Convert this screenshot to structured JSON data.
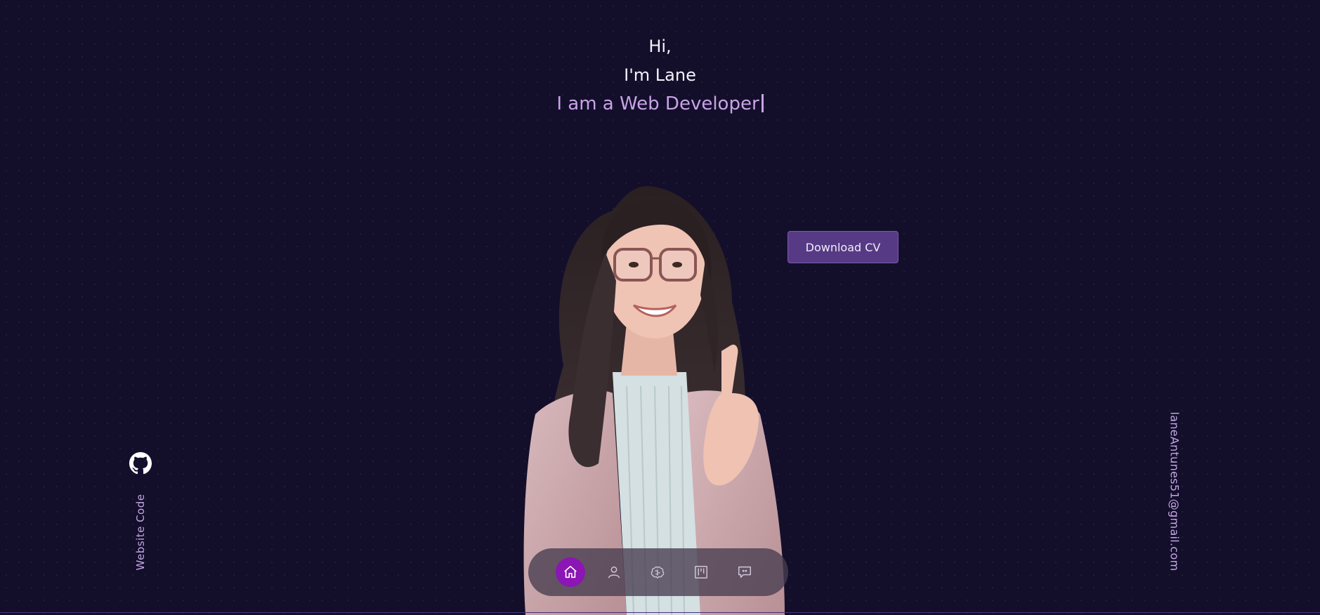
{
  "hero": {
    "greeting": "Hi,",
    "name_line": "I'm Lane",
    "role_line": "I am a Web Developer"
  },
  "actions": {
    "download_cv": "Download CV"
  },
  "social": {
    "github_icon": "github-icon",
    "website_code_label": "Website Code"
  },
  "contact": {
    "email": "laneAntunes51@gmail.com"
  },
  "nav": {
    "items": [
      {
        "icon": "home-icon",
        "active": true
      },
      {
        "icon": "user-icon",
        "active": false
      },
      {
        "icon": "brain-icon",
        "active": false
      },
      {
        "icon": "kanban-board-icon",
        "active": false
      },
      {
        "icon": "chat-icon",
        "active": false
      }
    ]
  },
  "colors": {
    "background": "#130f2b",
    "accent_purple": "#8b15b5",
    "button_purple": "#573a85",
    "role_text": "#c9a2e6"
  }
}
